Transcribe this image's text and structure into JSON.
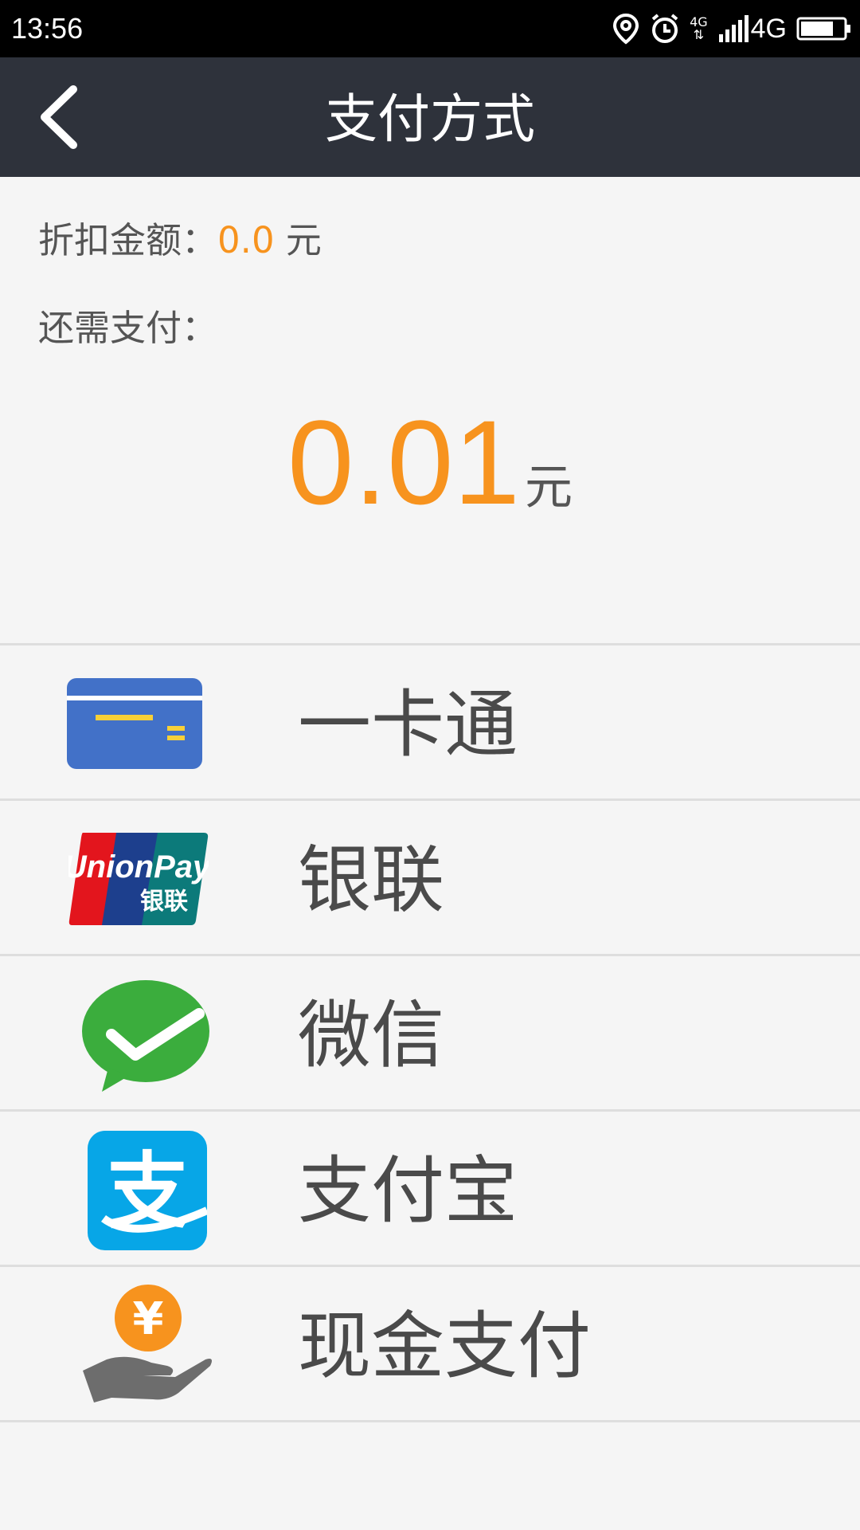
{
  "status_bar": {
    "time": "13:56",
    "network_small": "4G",
    "network": "4G",
    "icons": [
      "location-icon",
      "alarm-icon",
      "data-arrows-icon",
      "signal-icon",
      "battery-icon"
    ]
  },
  "header": {
    "title": "支付方式",
    "back_icon": "chevron-left-icon"
  },
  "summary": {
    "discount_label": "折扣金额：",
    "discount_value": "0.0",
    "discount_unit": "元",
    "remaining_label": "还需支付：",
    "remaining_value": "0.01",
    "remaining_unit": "元"
  },
  "payment_methods": [
    {
      "label": "一卡通",
      "icon": "card-icon"
    },
    {
      "label": "银联",
      "icon": "unionpay-icon",
      "logo_text": "UnionPay",
      "logo_text_cn": "银联"
    },
    {
      "label": "微信",
      "icon": "wechat-icon"
    },
    {
      "label": "支付宝",
      "icon": "alipay-icon",
      "logo_char": "支"
    },
    {
      "label": "现金支付",
      "icon": "cash-hand-icon",
      "logo_char": "¥"
    }
  ],
  "colors": {
    "accent": "#f7931e",
    "nav_bg": "#2e323b",
    "page_bg": "#f5f5f5",
    "text": "#4a4a4a"
  }
}
